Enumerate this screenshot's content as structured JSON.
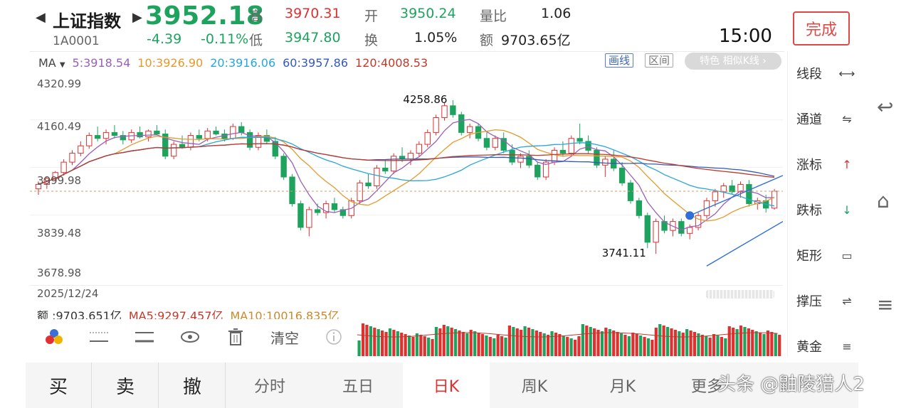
{
  "header": {
    "name": "上证指数",
    "code": "1A0001",
    "price": "3952.18",
    "change": "-4.39",
    "change_pct": "-0.11%",
    "high_label": "高",
    "high": "3970.31",
    "low_label": "低",
    "low": "3947.80",
    "open_label": "开",
    "open": "3950.24",
    "turnover_label": "换",
    "turnover": "1.05%",
    "vol_ratio_label": "量比",
    "vol_ratio": "1.06",
    "amount_label": "额",
    "amount": "9703.65亿",
    "time": "15:00",
    "done_label": "完成"
  },
  "ma_bar": {
    "select": "MA",
    "items": [
      {
        "text": "5:3918.54",
        "color": "#9a5fb8"
      },
      {
        "text": "10:3926.90",
        "color": "#e39a2a"
      },
      {
        "text": "20:3916.06",
        "color": "#27a6d8"
      },
      {
        "text": "60:3957.86",
        "color": "#3359b8"
      },
      {
        "text": "120:4008.53",
        "color": "#c0392b"
      }
    ],
    "draw_label": "画线",
    "range_label": "区间",
    "feature_label": "特色  相似K线 ›"
  },
  "chart_data": {
    "type": "candlestick",
    "y_axis_ticks": [
      "4320.99",
      "4160.49",
      "3999.98",
      "3839.48",
      "3678.98"
    ],
    "ylim": [
      3678.98,
      4320.99
    ],
    "annotations": {
      "high": "4258.86",
      "low": "3741.11"
    },
    "date": "2025/12/24",
    "candles": [
      [
        3960,
        3985,
        3940,
        3975
      ],
      [
        3975,
        4000,
        3960,
        3995
      ],
      [
        3995,
        4020,
        3985,
        4015
      ],
      [
        4015,
        4060,
        4005,
        4050
      ],
      [
        4050,
        4090,
        4040,
        4080
      ],
      [
        4080,
        4120,
        4070,
        4105
      ],
      [
        4105,
        4150,
        4095,
        4140
      ],
      [
        4140,
        4170,
        4120,
        4130
      ],
      [
        4130,
        4160,
        4110,
        4150
      ],
      [
        4150,
        4175,
        4130,
        4140
      ],
      [
        4140,
        4155,
        4110,
        4125
      ],
      [
        4125,
        4160,
        4115,
        4150
      ],
      [
        4150,
        4170,
        4130,
        4135
      ],
      [
        4135,
        4160,
        4120,
        4155
      ],
      [
        4155,
        4175,
        4140,
        4145
      ],
      [
        4145,
        4160,
        4060,
        4070
      ],
      [
        4070,
        4120,
        4060,
        4110
      ],
      [
        4110,
        4140,
        4095,
        4100
      ],
      [
        4100,
        4150,
        4090,
        4140
      ],
      [
        4140,
        4160,
        4120,
        4130
      ],
      [
        4130,
        4165,
        4120,
        4155
      ],
      [
        4155,
        4170,
        4140,
        4145
      ],
      [
        4145,
        4160,
        4120,
        4130
      ],
      [
        4130,
        4180,
        4125,
        4170
      ],
      [
        4170,
        4185,
        4140,
        4150
      ],
      [
        4150,
        4160,
        4090,
        4100
      ],
      [
        4100,
        4150,
        4090,
        4140
      ],
      [
        4140,
        4160,
        4110,
        4120
      ],
      [
        4120,
        4135,
        4060,
        4070
      ],
      [
        4070,
        4080,
        3990,
        4000
      ],
      [
        4000,
        4010,
        3900,
        3910
      ],
      [
        3910,
        3920,
        3820,
        3830
      ],
      [
        3830,
        3900,
        3800,
        3890
      ],
      [
        3890,
        3910,
        3870,
        3880
      ],
      [
        3880,
        3920,
        3860,
        3910
      ],
      [
        3910,
        3930,
        3880,
        3890
      ],
      [
        3890,
        3900,
        3860,
        3870
      ],
      [
        3870,
        3930,
        3860,
        3920
      ],
      [
        3920,
        3990,
        3910,
        3980
      ],
      [
        3980,
        4010,
        3960,
        3970
      ],
      [
        3970,
        4040,
        3960,
        4030
      ],
      [
        4030,
        4060,
        4010,
        4020
      ],
      [
        4020,
        4080,
        4010,
        4070
      ],
      [
        4070,
        4100,
        4050,
        4060
      ],
      [
        4060,
        4090,
        4040,
        4080
      ],
      [
        4080,
        4120,
        4070,
        4110
      ],
      [
        4110,
        4160,
        4100,
        4150
      ],
      [
        4150,
        4210,
        4140,
        4200
      ],
      [
        4200,
        4250,
        4190,
        4240
      ],
      [
        4240,
        4259,
        4200,
        4210
      ],
      [
        4210,
        4220,
        4140,
        4150
      ],
      [
        4150,
        4180,
        4130,
        4170
      ],
      [
        4170,
        4180,
        4120,
        4130
      ],
      [
        4130,
        4150,
        4090,
        4100
      ],
      [
        4100,
        4140,
        4090,
        4130
      ],
      [
        4130,
        4150,
        4080,
        4090
      ],
      [
        4090,
        4110,
        4040,
        4050
      ],
      [
        4050,
        4080,
        4030,
        4070
      ],
      [
        4070,
        4090,
        4030,
        4040
      ],
      [
        4040,
        4050,
        3990,
        4000
      ],
      [
        4000,
        4060,
        3990,
        4050
      ],
      [
        4050,
        4100,
        4040,
        4090
      ],
      [
        4090,
        4120,
        4070,
        4080
      ],
      [
        4080,
        4140,
        4070,
        4130
      ],
      [
        4130,
        4180,
        4110,
        4120
      ],
      [
        4120,
        4140,
        4080,
        4090
      ],
      [
        4090,
        4100,
        4030,
        4040
      ],
      [
        4040,
        4070,
        4000,
        4060
      ],
      [
        4060,
        4090,
        4020,
        4030
      ],
      [
        4030,
        4050,
        3970,
        3980
      ],
      [
        3980,
        3990,
        3910,
        3920
      ],
      [
        3920,
        3930,
        3860,
        3870
      ],
      [
        3870,
        3880,
        3760,
        3780
      ],
      [
        3780,
        3860,
        3741,
        3850
      ],
      [
        3850,
        3870,
        3810,
        3820
      ],
      [
        3820,
        3860,
        3800,
        3850
      ],
      [
        3850,
        3860,
        3800,
        3810
      ],
      [
        3810,
        3840,
        3790,
        3830
      ],
      [
        3830,
        3880,
        3820,
        3870
      ],
      [
        3870,
        3930,
        3860,
        3920
      ],
      [
        3920,
        3960,
        3900,
        3950
      ],
      [
        3950,
        3980,
        3930,
        3970
      ],
      [
        3970,
        3990,
        3940,
        3950
      ],
      [
        3950,
        3985,
        3930,
        3975
      ],
      [
        3975,
        3990,
        3900,
        3910
      ],
      [
        3910,
        3930,
        3890,
        3920
      ],
      [
        3920,
        3940,
        3880,
        3895
      ],
      [
        3895,
        3960,
        3890,
        3952
      ]
    ]
  },
  "date_row": {
    "date": "2025/12/24"
  },
  "volume": {
    "amount": "额 :9703.651亿",
    "ma5": "MA5:9297.457亿",
    "ma10": "MA10:10016.835亿"
  },
  "tools": {
    "clear_label": "清空"
  },
  "sidebar": {
    "items": [
      {
        "label": "线段",
        "icon": "line-segment-icon",
        "glyph": "⟷"
      },
      {
        "label": "通道",
        "icon": "channel-icon",
        "glyph": "⇋"
      },
      {
        "label": "涨标",
        "icon": "rise-arrow-icon",
        "glyph": "↑"
      },
      {
        "label": "跌标",
        "icon": "fall-arrow-icon",
        "glyph": "↓"
      },
      {
        "label": "矩形",
        "icon": "rectangle-icon",
        "glyph": "▭"
      },
      {
        "label": "撑压",
        "icon": "support-resistance-icon",
        "glyph": "⇌"
      },
      {
        "label": "黄金",
        "icon": "golden-ratio-icon",
        "glyph": "≡"
      }
    ]
  },
  "tabs": [
    {
      "label": "买"
    },
    {
      "label": "卖"
    },
    {
      "label": "撤"
    },
    {
      "label": "分时"
    },
    {
      "label": "五日"
    },
    {
      "label": "日K"
    },
    {
      "label": "周K"
    },
    {
      "label": "月K"
    },
    {
      "label": "更多"
    }
  ],
  "watermark": "头条 @鼬陵猎人2",
  "colors": {
    "up": "#e03131",
    "down": "#1ea35f",
    "accent": "#e04848"
  }
}
